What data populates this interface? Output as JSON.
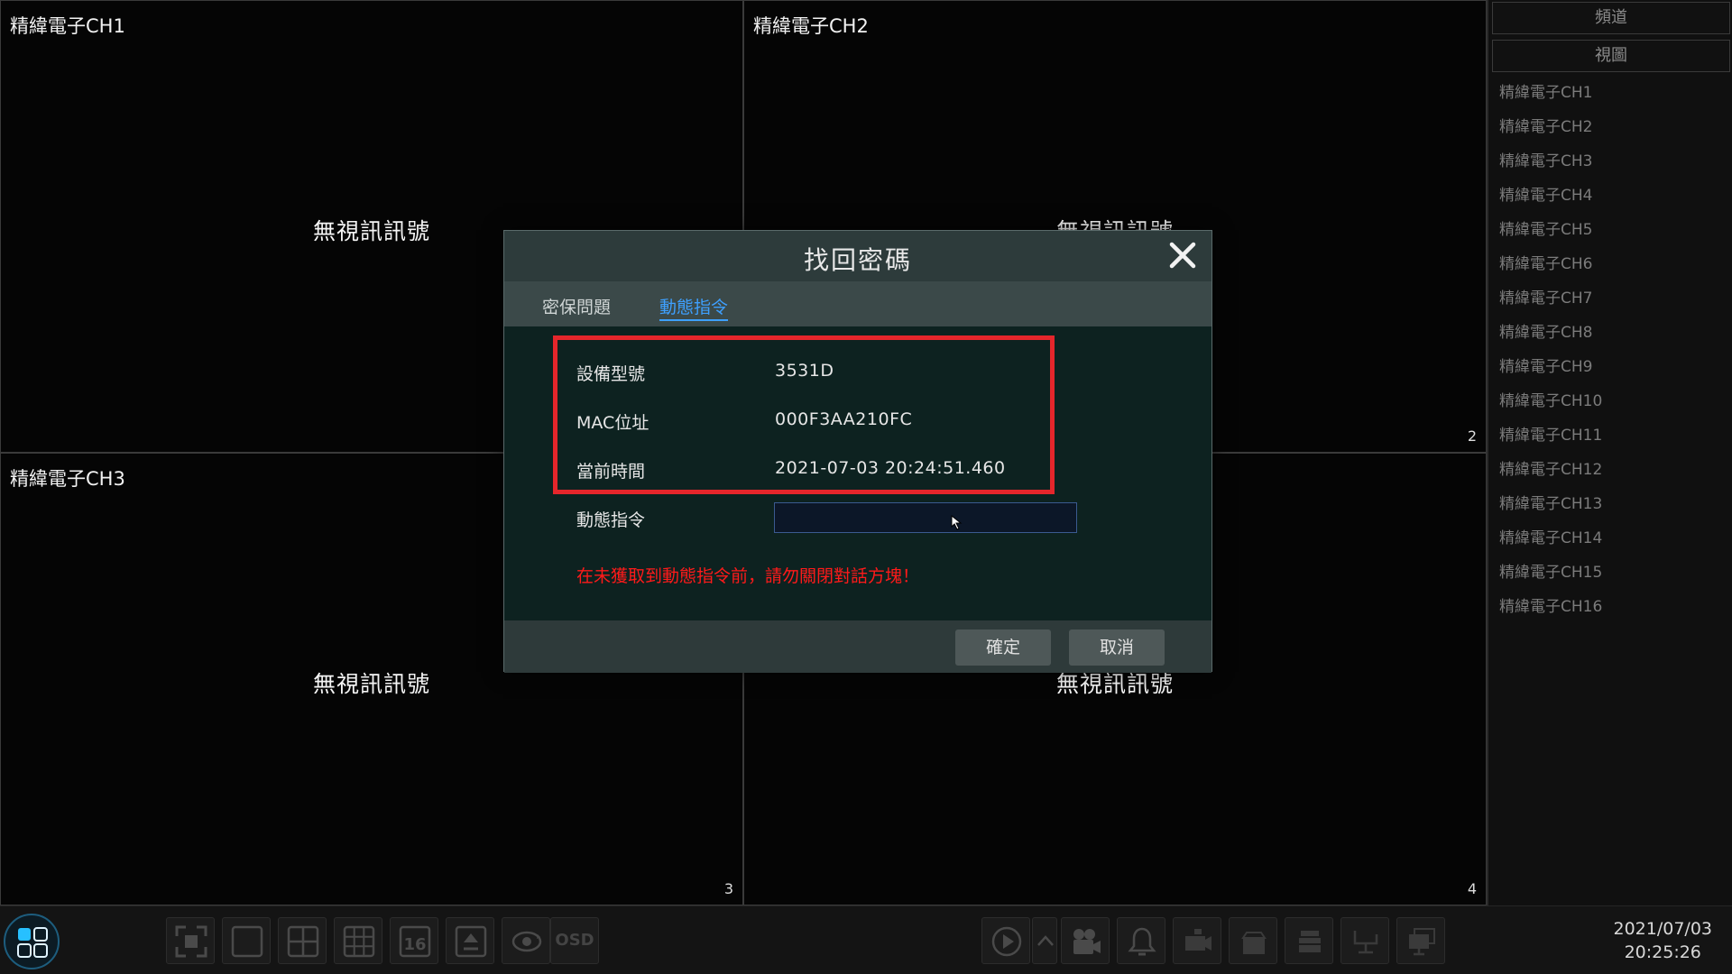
{
  "channels": [
    {
      "name": "精緯電子CH1",
      "status": "無視訊訊號",
      "num": ""
    },
    {
      "name": "精緯電子CH2",
      "status": "無視訊訊號",
      "num": "2"
    },
    {
      "name": "精緯電子CH3",
      "status": "無視訊訊號",
      "num": "3"
    },
    {
      "name": "",
      "status": "無視訊訊號",
      "num": "4"
    }
  ],
  "sidebar": {
    "btn_channel": "頻道",
    "btn_view": "視圖",
    "items": [
      "精緯電子CH1",
      "精緯電子CH2",
      "精緯電子CH3",
      "精緯電子CH4",
      "精緯電子CH5",
      "精緯電子CH6",
      "精緯電子CH7",
      "精緯電子CH8",
      "精緯電子CH9",
      "精緯電子CH10",
      "精緯電子CH11",
      "精緯電子CH12",
      "精緯電子CH13",
      "精緯電子CH14",
      "精緯電子CH15",
      "精緯電子CH16"
    ]
  },
  "toolbar": {
    "osd_label": "OSD",
    "grid16_label": "16",
    "date": "2021/07/03",
    "time": "20:25:26"
  },
  "dialog": {
    "title": "找回密碼",
    "tabs": {
      "security_question": "密保問題",
      "dynamic_command": "動態指令"
    },
    "device_model_label": "設備型號",
    "device_model_value": "3531D",
    "mac_label": "MAC位址",
    "mac_value": "000F3AA210FC",
    "time_label": "當前時間",
    "time_value": "2021-07-03 20:24:51.460",
    "command_label": "動態指令",
    "command_value": "",
    "warning": "在未獲取到動態指令前，請勿關閉對話方塊！",
    "ok_label": "確定",
    "cancel_label": "取消"
  },
  "colors": {
    "accent": "#3ea0ff",
    "highlight_box": "#e5262b",
    "warning": "#ff1a1a"
  }
}
